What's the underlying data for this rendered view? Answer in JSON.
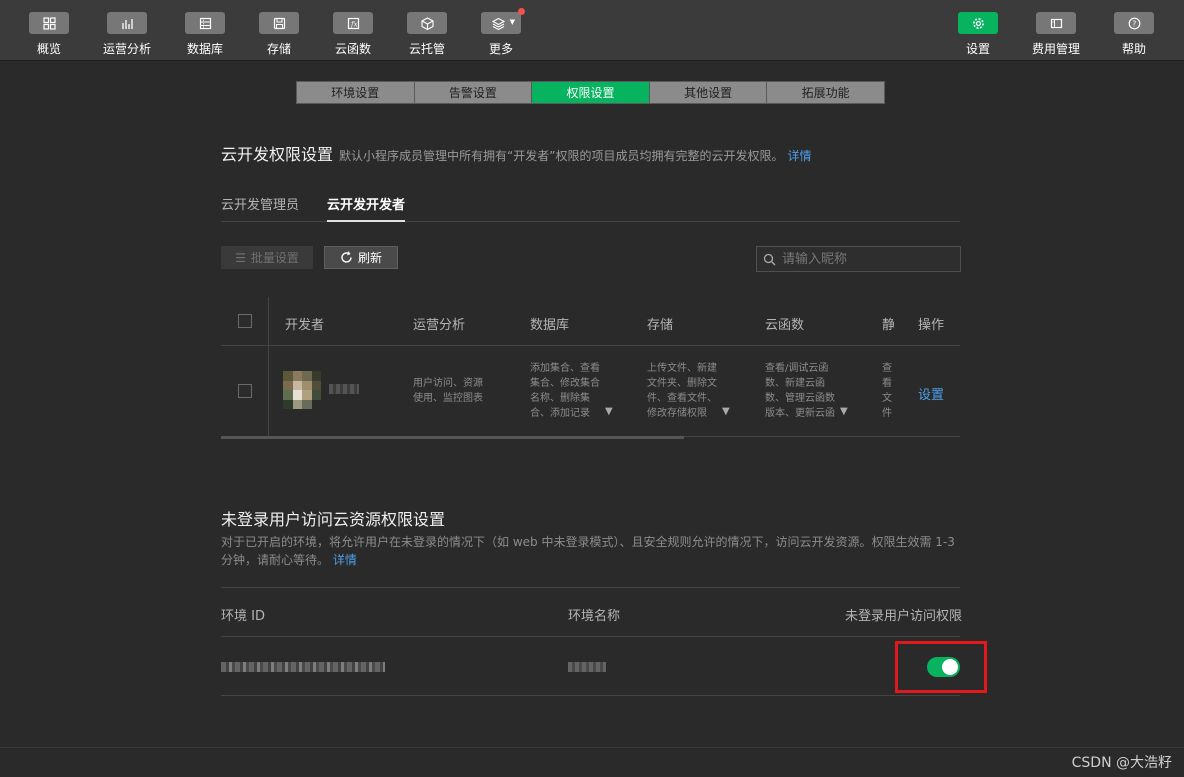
{
  "nav": {
    "left": [
      {
        "label": "概览",
        "icon": "overview-icon"
      },
      {
        "label": "运营分析",
        "icon": "analytics-icon"
      },
      {
        "label": "数据库",
        "icon": "database-icon"
      },
      {
        "label": "存储",
        "icon": "storage-icon"
      },
      {
        "label": "云函数",
        "icon": "function-icon"
      },
      {
        "label": "云托管",
        "icon": "cube-icon"
      },
      {
        "label": "更多",
        "icon": "layers-icon"
      }
    ],
    "right": [
      {
        "label": "设置",
        "icon": "gear-icon"
      },
      {
        "label": "费用管理",
        "icon": "billing-icon"
      },
      {
        "label": "帮助",
        "icon": "help-icon"
      }
    ]
  },
  "tabs": [
    "环境设置",
    "告警设置",
    "权限设置",
    "其他设置",
    "拓展功能"
  ],
  "active_tab": "权限设置",
  "permission": {
    "title": "云开发权限设置",
    "desc": "默认小程序成员管理中所有拥有“开发者”权限的项目成员均拥有完整的云开发权限。",
    "detail_link": "详情",
    "subtabs": [
      "云开发管理员",
      "云开发开发者"
    ],
    "active_subtab": "云开发开发者",
    "batch_button": "批量设置",
    "refresh_button": "刷新",
    "search_placeholder": "请输入昵称",
    "table": {
      "headers": [
        "开发者",
        "运营分析",
        "数据库",
        "存储",
        "云函数",
        "静",
        "操作"
      ],
      "row": {
        "analytics": "用户访问、资源使用、监控图表",
        "database": "添加集合、查看集合、修改集合名称、删除集合、添加记录",
        "storage": "上传文件、新建文件夹、删除文件、查看文件、修改存储权限",
        "functions": "查看/调试云函数、新建云函数、管理云函数版本、更新云函数",
        "static": "查看文件管理状态",
        "action": "设置"
      }
    }
  },
  "guest": {
    "title": "未登录用户访问云资源权限设置",
    "desc": "对于已开启的环境，将允许用户在未登录的情况下（如 web 中未登录模式）、且安全规则允许的情况下，访问云开发资源。权限生效需 1-3 分钟，请耐心等待。",
    "detail_link": "详情",
    "headers": [
      "环境 ID",
      "环境名称",
      "未登录用户访问权限"
    ],
    "toggle_on": true
  },
  "watermark": "CSDN @大浩籽",
  "colors": {
    "accent": "#07b35e",
    "link": "#4e9fea",
    "highlight": "#e3181c"
  }
}
